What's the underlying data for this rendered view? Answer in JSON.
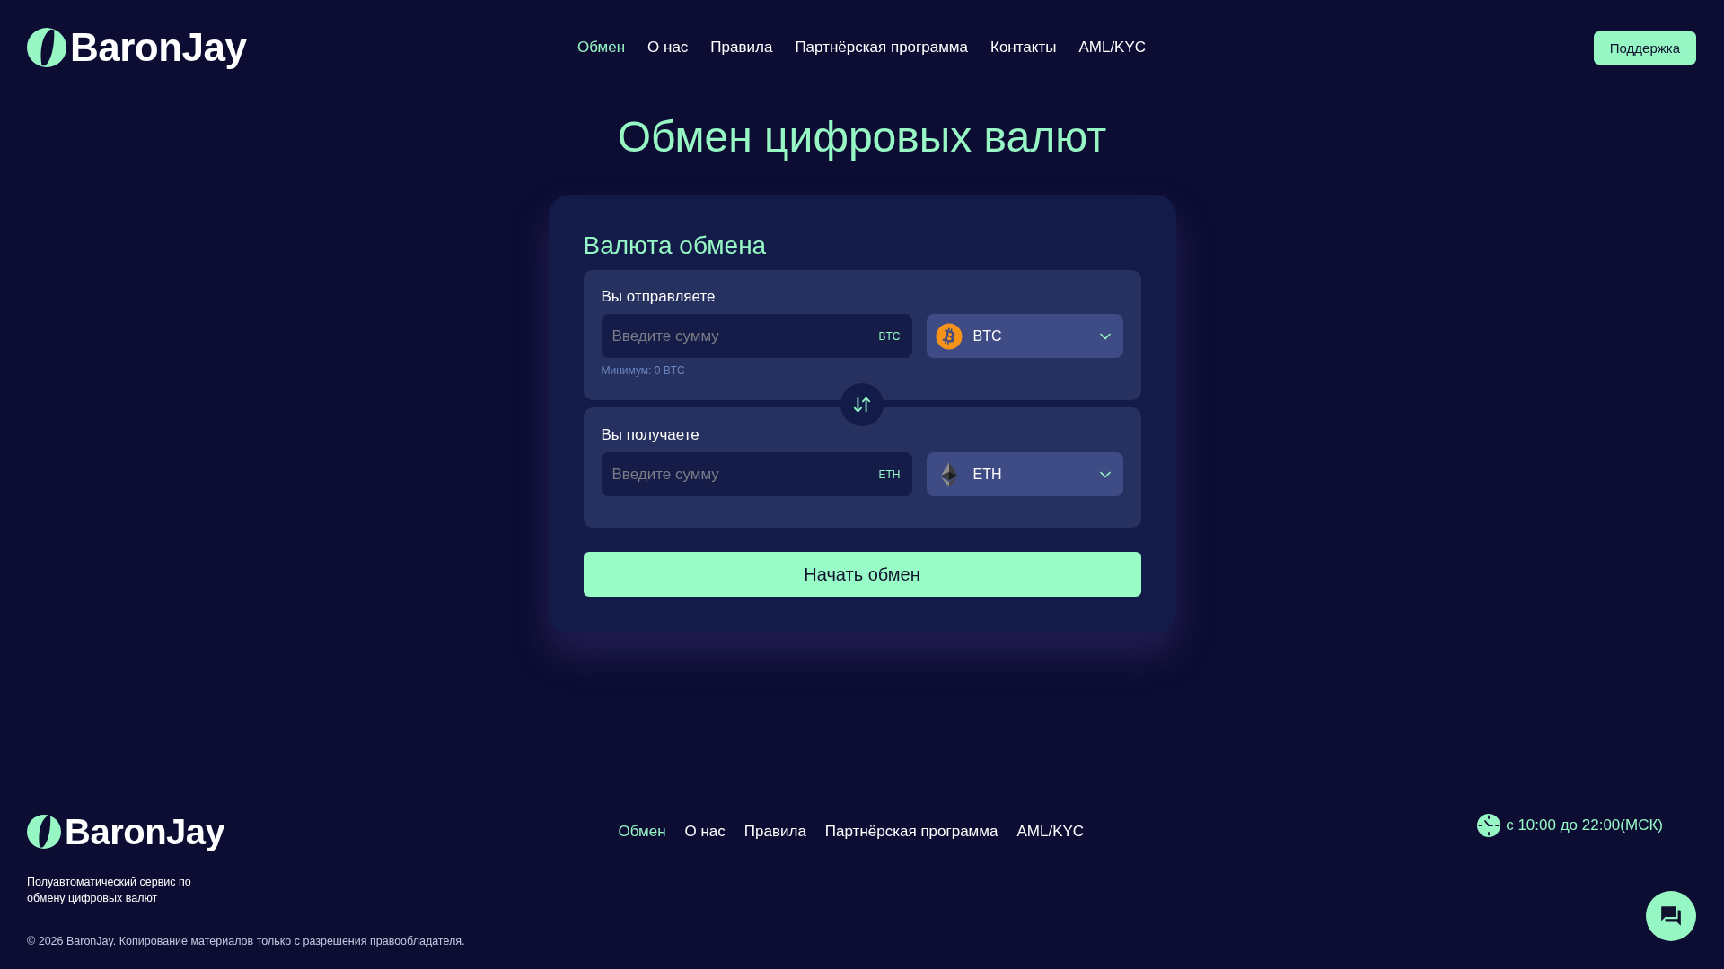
{
  "header": {
    "logo": "BaronJay",
    "nav": [
      {
        "label": "Обмен",
        "selected": true
      },
      {
        "label": "О нас",
        "selected": false
      },
      {
        "label": "Правила",
        "selected": false
      },
      {
        "label": "Партнёрская программа",
        "selected": false
      },
      {
        "label": "Контакты",
        "selected": false
      },
      {
        "label": "AML/KYC",
        "selected": false
      }
    ],
    "support_button": "Поддержка"
  },
  "title": "Обмен цифровых валют",
  "exchange": {
    "heading": "Валюта обмена",
    "send": {
      "label": "Вы отправляете",
      "amount": {
        "placeholder": "Введите сумму",
        "unit": "BTC"
      },
      "currency": {
        "code": "BTC",
        "kind": "bitcoin"
      },
      "minimum": "Минимум: 0 BTC"
    },
    "receive": {
      "label": "Вы получаете",
      "amount": {
        "placeholder": "Введите сумму",
        "unit": "ETH"
      },
      "currency": {
        "code": "ETH",
        "kind": "ethereum"
      }
    },
    "submit": "Начать обмен"
  },
  "footer": {
    "logo": "BaronJay",
    "nav": [
      {
        "label": "Обмен",
        "selected": true
      },
      {
        "label": "О нас",
        "selected": false
      },
      {
        "label": "Правила",
        "selected": false
      },
      {
        "label": "Партнёрская программа",
        "selected": false
      },
      {
        "label": "AML/KYC",
        "selected": false
      }
    ],
    "hours": "с 10:00 до 22:00(МСК)",
    "description": "Полуавтоматический сервис по обмену цифровых валют",
    "copyright": "© 2026 BaronJay. Копирование материалов только с разрешения правообладателя."
  }
}
